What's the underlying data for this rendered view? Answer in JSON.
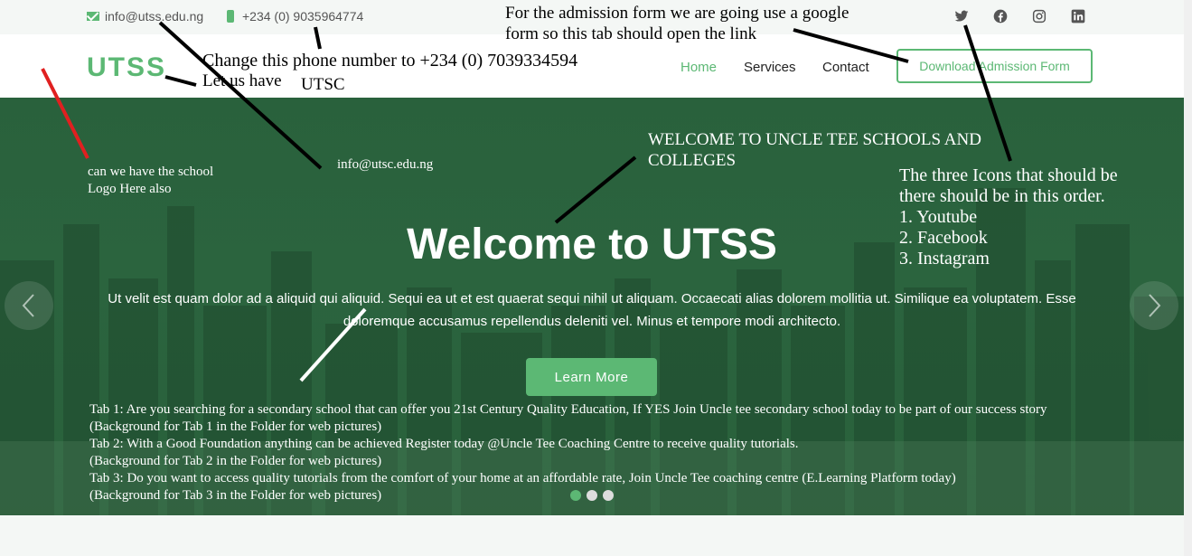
{
  "topbar": {
    "email": "info@utss.edu.ng",
    "phone": "+234 (0) 9035964774",
    "social_icons": [
      "twitter-icon",
      "facebook-icon",
      "instagram-icon",
      "linkedin-icon"
    ]
  },
  "header": {
    "logo": "UTSS",
    "nav": [
      "Home",
      "Services",
      "Contact"
    ],
    "active_nav": "Home",
    "download_button": "Download Admission Form"
  },
  "hero": {
    "title": "Welcome to UTSS",
    "text": "Ut velit est quam dolor ad a aliquid qui aliquid. Sequi ea ut et est quaerat sequi nihil ut aliquam. Occaecati alias dolorem mollitia ut. Similique ea voluptatem. Esse doloremque accusamus repellendus deleniti vel. Minus et tempore modi architecto.",
    "button": "Learn More",
    "slides": 3,
    "active_slide": 1
  },
  "annotations": {
    "form_note_1": "For the admission form we are going use a google",
    "form_note_2": "form so this tab should open the link",
    "phone_note": "Change this phone number to +234 (0) 7039334594",
    "letus_note": "Let us have",
    "utsc_note": "UTSC",
    "logo_note_1": "can we have the school",
    "logo_note_2": "Logo Here also",
    "email_note": "info@utsc.edu.ng",
    "welcome_note_1": "WELCOME TO UNCLE TEE SCHOOLS AND",
    "welcome_note_2": "COLLEGES",
    "icons_note_1": "The three Icons that should be",
    "icons_note_2": "there should be in this order.",
    "icons_note_3": "1. Youtube",
    "icons_note_4": "2. Facebook",
    "icons_note_5": "3. Instagram",
    "tab1": "Tab 1: Are you searching for a secondary school that can offer you 21st Century Quality Education, If YES Join Uncle tee secondary school today to be part of our success story",
    "tab1_bg": "(Background for Tab 1 in the Folder for web pictures)",
    "tab2": "Tab 2: With a Good Foundation anything can be achieved Register today @Uncle Tee Coaching Centre to receive quality tutorials.",
    "tab2_bg": "(Background for Tab 2 in the Folder for web pictures)",
    "tab3": "Tab 3: Do you want to access quality tutorials from the comfort of your home at an affordable rate, Join Uncle Tee coaching centre (E.Learning Platform today)",
    "tab3_bg": "(Background for Tab 3 in the Folder for web pictures)"
  },
  "colors": {
    "accent": "#5cb874",
    "hero_overlay": "#28623c"
  }
}
